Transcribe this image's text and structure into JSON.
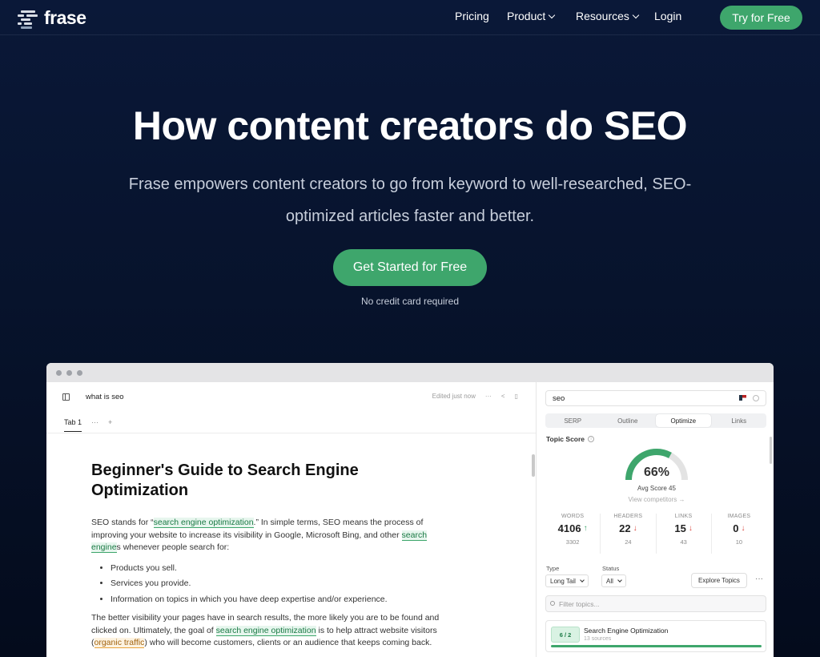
{
  "brand": {
    "name": "frase",
    "accent": "#3ea66c"
  },
  "nav": {
    "links": [
      "Pricing",
      "Product",
      "Resources",
      "Login"
    ],
    "cta": "Try for Free"
  },
  "hero": {
    "title": "How content creators do SEO",
    "subtitle": "Frase empowers content creators to go from keyword to well-researched, SEO-optimized articles faster and better.",
    "cta": "Get Started for Free",
    "note": "No credit card required"
  },
  "editor": {
    "doc_title": "what is seo",
    "saved": "Edited just now",
    "tab": "Tab 1",
    "heading": "Beginner's Guide to Search Engine Optimization",
    "p1": {
      "a": "SEO stands for “",
      "h1": "search engine optimization",
      "b": ".” In simple terms, SEO means the process of improving your website to increase its visibility in Google, Microsoft Bing, and other ",
      "h2": "search engine",
      "c": "s whenever people search for:"
    },
    "bullets": [
      "Products you sell.",
      "Services you provide.",
      "Information on topics in which you have deep expertise and/or experience."
    ],
    "p2": {
      "a": "The better visibility your pages have in search results, the more likely you are to be found and clicked on. Ultimately, the goal of ",
      "h1": "search engine optimization",
      "b": " is to help attract website visitors (",
      "h2": "organic traffic",
      "c": ") who will become customers, clients or an audience that keeps coming back."
    }
  },
  "panel": {
    "query": "seo",
    "tabs": [
      "SERP",
      "Outline",
      "Optimize",
      "Links"
    ],
    "active_tab": "Optimize",
    "topic_score_label": "Topic Score",
    "score": "66%",
    "score_fraction": 0.66,
    "avg_score": "Avg Score 45",
    "view_competitors": "View competitors →",
    "stats": [
      {
        "label": "WORDS",
        "value": "4106",
        "dir": "up",
        "target": "3302"
      },
      {
        "label": "HEADERS",
        "value": "22",
        "dir": "down",
        "target": "24"
      },
      {
        "label": "LINKS",
        "value": "15",
        "dir": "down",
        "target": "43"
      },
      {
        "label": "IMAGES",
        "value": "0",
        "dir": "down",
        "target": "10"
      }
    ],
    "type_label": "Type",
    "type_value": "Long Tail",
    "status_label": "Status",
    "status_value": "All",
    "explore": "Explore Topics",
    "filter_placeholder": "Filter topics...",
    "topic": {
      "badge": "6 / 2",
      "title": "Search Engine Optimization",
      "sources": "13 sources"
    }
  }
}
